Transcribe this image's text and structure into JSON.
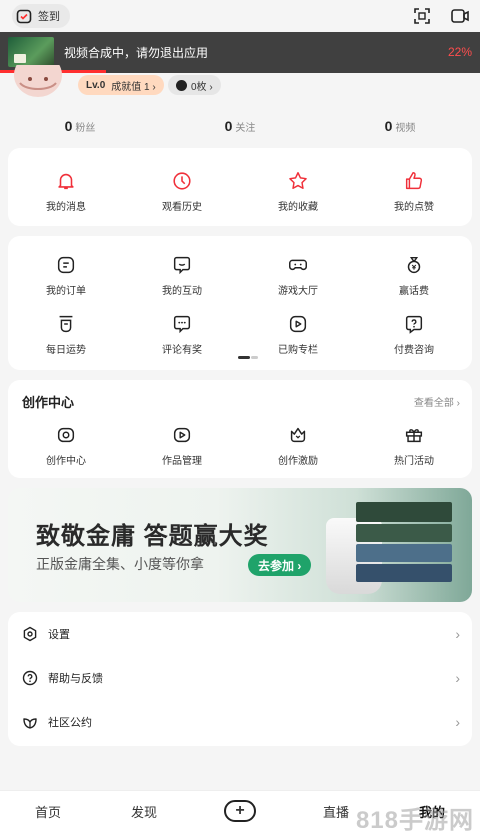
{
  "header": {
    "signin_label": "签到"
  },
  "upload": {
    "message": "视频合成中，请勿退出应用",
    "percent_text": "22%",
    "progress": 0.22
  },
  "profile": {
    "level": "Lv.0",
    "achievement": "成就值 1 ›",
    "coins": "0枚 ›"
  },
  "stats": [
    {
      "count": "0",
      "label": "粉丝"
    },
    {
      "count": "0",
      "label": "关注"
    },
    {
      "count": "0",
      "label": "视频"
    }
  ],
  "quick": [
    {
      "label": "我的消息",
      "icon": "bell-icon"
    },
    {
      "label": "观看历史",
      "icon": "clock-icon"
    },
    {
      "label": "我的收藏",
      "icon": "star-icon"
    },
    {
      "label": "我的点赞",
      "icon": "thumbs-up-icon"
    }
  ],
  "services": [
    {
      "label": "我的订单",
      "icon": "order-icon"
    },
    {
      "label": "我的互动",
      "icon": "chat-icon"
    },
    {
      "label": "游戏大厅",
      "icon": "gamepad-icon"
    },
    {
      "label": "赢话费",
      "icon": "money-bag-icon"
    },
    {
      "label": "每日运势",
      "icon": "fortune-icon"
    },
    {
      "label": "评论有奖",
      "icon": "comment-icon"
    },
    {
      "label": "已购专栏",
      "icon": "play-column-icon"
    },
    {
      "label": "付费咨询",
      "icon": "question-icon"
    }
  ],
  "creator": {
    "title": "创作中心",
    "more": "查看全部 ›",
    "items": [
      {
        "label": "创作中心",
        "icon": "camera-icon"
      },
      {
        "label": "作品管理",
        "icon": "video-manage-icon"
      },
      {
        "label": "创作激励",
        "icon": "crown-icon"
      },
      {
        "label": "热门活动",
        "icon": "gift-icon"
      }
    ]
  },
  "promo": {
    "title": "致敬金庸 答题赢大奖",
    "subtitle": "正版金庸全集、小度等你拿",
    "button": "去参加 ›"
  },
  "menu": [
    {
      "label": "设置",
      "icon": "settings-icon"
    },
    {
      "label": "帮助与反馈",
      "icon": "help-icon"
    },
    {
      "label": "社区公约",
      "icon": "leaf-icon"
    }
  ],
  "tabs": {
    "home": "首页",
    "discover": "发现",
    "live": "直播",
    "mine": "我的"
  },
  "watermark": "818手游网",
  "colors": {
    "accent_red": "#ff2f2f",
    "promo_green": "#1fa36a"
  }
}
